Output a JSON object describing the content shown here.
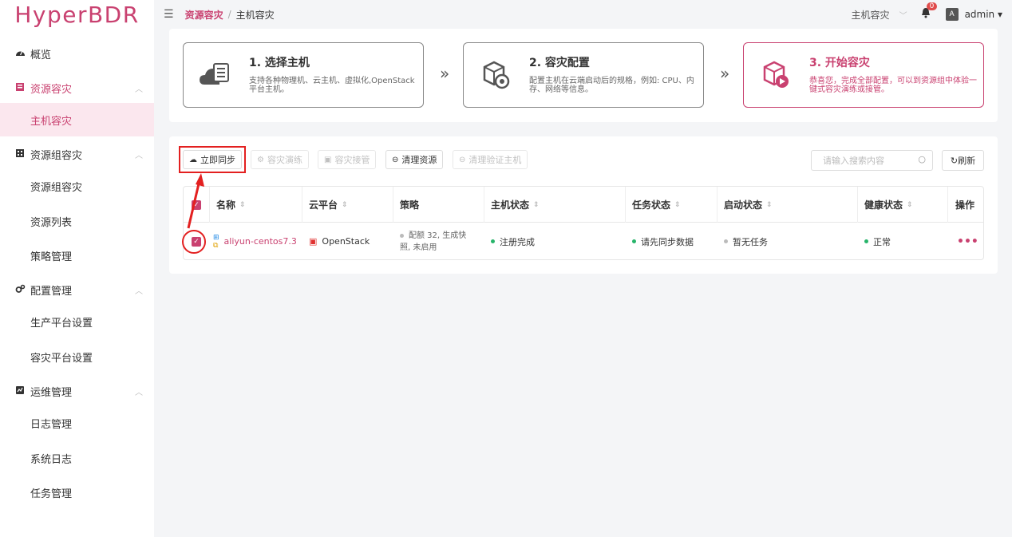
{
  "app": {
    "logo": "HyperBDR"
  },
  "sidebar": {
    "items": [
      {
        "label": "概览",
        "icon": "dashboard-icon"
      },
      {
        "label": "资源容灾",
        "icon": "server-icon",
        "expanded": true,
        "active": true
      },
      {
        "label": "主机容灾",
        "selected": true
      },
      {
        "label": "资源组容灾",
        "icon": "building-icon",
        "expanded": true
      },
      {
        "label": "资源组容灾"
      },
      {
        "label": "资源列表"
      },
      {
        "label": "策略管理"
      },
      {
        "label": "配置管理",
        "icon": "gears-icon",
        "expanded": true
      },
      {
        "label": "生产平台设置"
      },
      {
        "label": "容灾平台设置"
      },
      {
        "label": "运维管理",
        "icon": "monitor-icon",
        "expanded": true
      },
      {
        "label": "日志管理"
      },
      {
        "label": "系统日志"
      },
      {
        "label": "任务管理"
      }
    ]
  },
  "header": {
    "breadcrumb": [
      "资源容灾",
      "主机容灾"
    ],
    "separator": "/",
    "scope_select": "主机容灾",
    "notification_count": "0",
    "lang_icon": "A",
    "user": "admin ▾"
  },
  "steps": [
    {
      "title": "1. 选择主机",
      "desc": "支持各种物理机、云主机、虚拟化,OpenStack平台主机。"
    },
    {
      "title": "2. 容灾配置",
      "desc": "配置主机在云端启动后的规格，例如: CPU、内存、网络等信息。"
    },
    {
      "title": "3. 开始容灾",
      "desc": "恭喜您，完成全部配置，可以到资源组中体验一键式容灾演练或接管。"
    }
  ],
  "toolbar": {
    "sync": "立即同步",
    "drill": "容灾演练",
    "takeover": "容灾接管",
    "clean": "清理资源",
    "clean_verify": "清理验证主机",
    "search_placeholder": "请输入搜索内容",
    "refresh": "刷新"
  },
  "table": {
    "headers": [
      "名称",
      "云平台",
      "策略",
      "主机状态",
      "任务状态",
      "启动状态",
      "健康状态",
      "操作"
    ],
    "rows": [
      {
        "name": "aliyun-centos7.3",
        "platform": "OpenStack",
        "policy_line1": "配额 32, 生成快",
        "policy_line2": "照, 未启用",
        "host_status": "注册完成",
        "task_status": "请先同步数据",
        "boot_status": "暂无任务",
        "health": "正常",
        "actions": "•••"
      }
    ]
  },
  "colors": {
    "accent": "#c94170",
    "annotation": "#e32020",
    "ok": "#27b46a"
  }
}
